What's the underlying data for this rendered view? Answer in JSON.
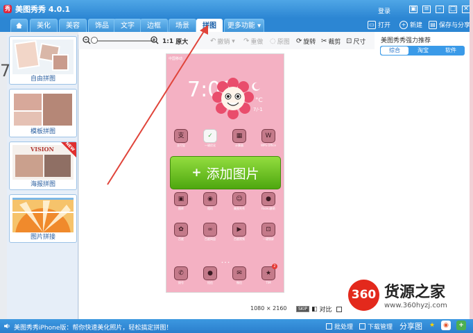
{
  "app": {
    "title": "美图秀秀 4.0.1",
    "logo": "秀"
  },
  "titlebar": {
    "login": "登录"
  },
  "tabs": [
    {
      "label": "美化"
    },
    {
      "label": "美容"
    },
    {
      "label": "饰品"
    },
    {
      "label": "文字"
    },
    {
      "label": "边框"
    },
    {
      "label": "场景"
    },
    {
      "label": "拼图"
    },
    {
      "label": "更多功能"
    }
  ],
  "actions": {
    "open": "打开",
    "new": "新建",
    "save": "保存与分享"
  },
  "toolbar": {
    "ratio": "1:1",
    "original": "原大",
    "undo": "撤销",
    "redo": "重做",
    "reset": "原图",
    "rotate": "旋转",
    "crop": "裁剪",
    "size": "尺寸"
  },
  "templates": [
    {
      "label": "自由拼图"
    },
    {
      "label": "模板拼图"
    },
    {
      "label": "海报拼图",
      "thumb_text": "VISION",
      "badge": "NEW"
    },
    {
      "label": "图片拼接"
    }
  ],
  "phone": {
    "status": "中国移动",
    "clock": "7:00",
    "temp": "°C",
    "date": "7/-1",
    "apps_row1": [
      {
        "label": "支付宝",
        "glyph": "支"
      },
      {
        "label": "一键优化",
        "glyph": "✓"
      },
      {
        "label": "计算器",
        "glyph": "▦"
      },
      {
        "label": "WPS Office",
        "glyph": "W"
      }
    ],
    "add_button": "添加图片",
    "apps_row2": [
      {
        "label": "图库",
        "glyph": "▣"
      },
      {
        "label": "相机",
        "glyph": "◉"
      },
      {
        "label": "美图秀秀",
        "glyph": "☺"
      },
      {
        "label": "Faceu激萌",
        "glyph": "●"
      }
    ],
    "apps_row3": [
      {
        "label": "百度",
        "glyph": "✿"
      },
      {
        "label": "百度网盘",
        "glyph": "∞"
      },
      {
        "label": "百度视频",
        "glyph": "▶"
      },
      {
        "label": "一键锁屏",
        "glyph": "⊡"
      }
    ],
    "apps_row4": [
      {
        "label": "拨号",
        "glyph": "✆"
      },
      {
        "label": "短信",
        "glyph": "●"
      },
      {
        "label": "微信",
        "glyph": "✉"
      },
      {
        "label": "TIM",
        "glyph": "★",
        "badge": "2"
      }
    ],
    "page_dots": "• • •"
  },
  "canvas": {
    "dimensions": "1080 × 2160",
    "compare": "对比",
    "compare_skip": "SKIP"
  },
  "right_panel": {
    "title": "美图秀秀强力推荐",
    "tabs": [
      {
        "label": "综合"
      },
      {
        "label": "淘宝"
      },
      {
        "label": "软件"
      }
    ]
  },
  "watermark": {
    "logo": "360",
    "name": "货源之家",
    "url": "www.360hyzj.com"
  },
  "statusbar": {
    "text": "美图秀秀iPhone版：帮你快速美化照片，轻松搞定拼图！",
    "batch": "批处理",
    "download": "下载管理",
    "share": "分享图"
  },
  "colors": {
    "title_bar": "#2c86d3",
    "add_button": "#5bb516",
    "phone_bg": "#f4b1c3",
    "arrow": "#e0443a"
  }
}
